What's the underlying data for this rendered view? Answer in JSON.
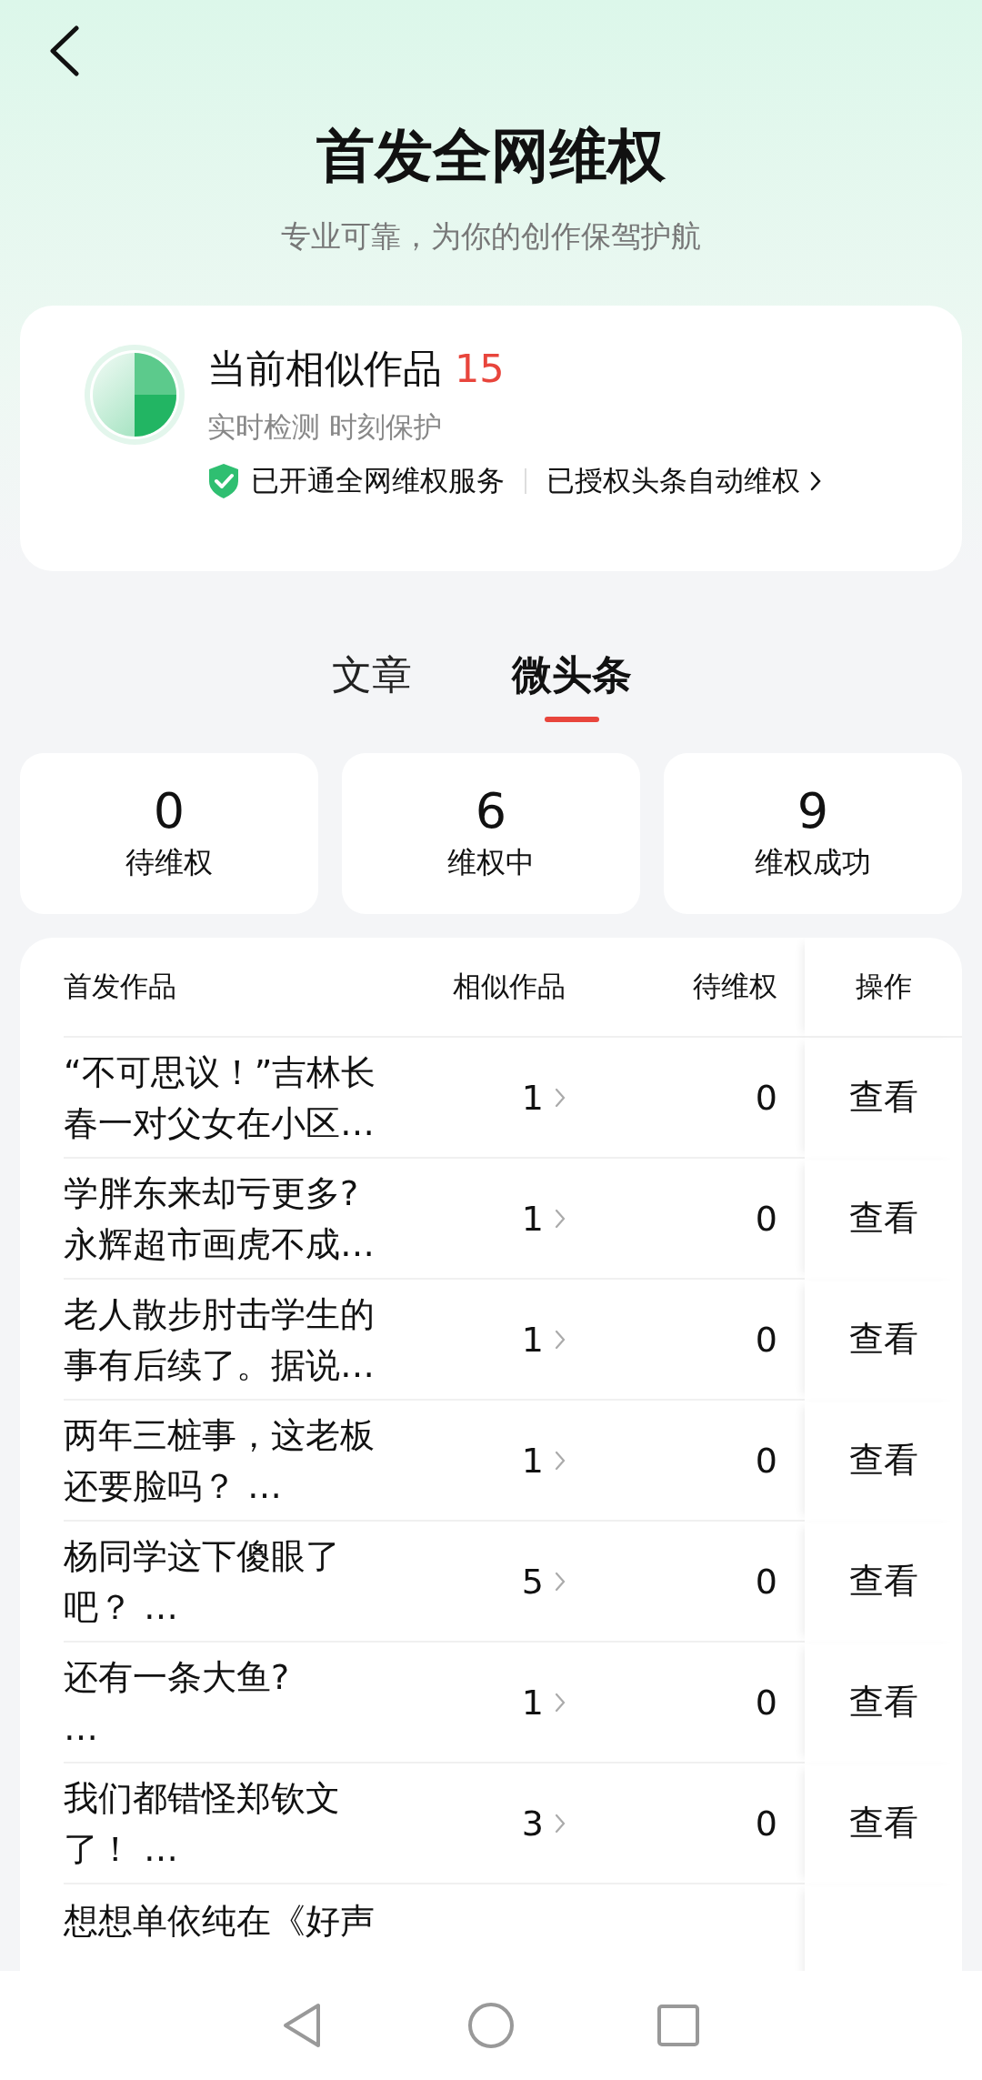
{
  "header": {
    "title": "首发全网维权",
    "subtitle": "专业可靠，为你的创作保驾护航"
  },
  "summary": {
    "label": "当前相似作品",
    "count": "15",
    "caption": "实时检测 时刻保护",
    "service": "已开通全网维权服务",
    "auto_link": "已授权头条自动维权"
  },
  "tabs": [
    {
      "label": "文章",
      "selected": false
    },
    {
      "label": "微头条",
      "selected": true
    }
  ],
  "stats": [
    {
      "value": "0",
      "label": "待维权"
    },
    {
      "value": "6",
      "label": "维权中"
    },
    {
      "value": "9",
      "label": "维权成功"
    }
  ],
  "table": {
    "columns": [
      "首发作品",
      "相似作品",
      "待维权",
      "操作"
    ],
    "rows": [
      {
        "title": "“不可思议！”吉林长春一对父女在小区…",
        "similar": "1",
        "pending": "0",
        "action": "查看"
      },
      {
        "title": "学胖东来却亏更多?\n永辉超市画虎不成…",
        "similar": "1",
        "pending": "0",
        "action": "查看"
      },
      {
        "title": "老人散步肘击学生的事有后续了。据说…",
        "similar": "1",
        "pending": "0",
        "action": "查看"
      },
      {
        "title": "两年三桩事，这老板还要脸吗？ …",
        "similar": "1",
        "pending": "0",
        "action": "查看"
      },
      {
        "title": "杨同学这下傻眼了吧？ …",
        "similar": "5",
        "pending": "0",
        "action": "查看"
      },
      {
        "title": "还有一条大鱼?\n…",
        "similar": "1",
        "pending": "0",
        "action": "查看"
      },
      {
        "title": "我们都错怪郑钦文了！ …",
        "similar": "3",
        "pending": "0",
        "action": "查看"
      },
      {
        "title": "想想单依纯在《好声"
      }
    ]
  }
}
